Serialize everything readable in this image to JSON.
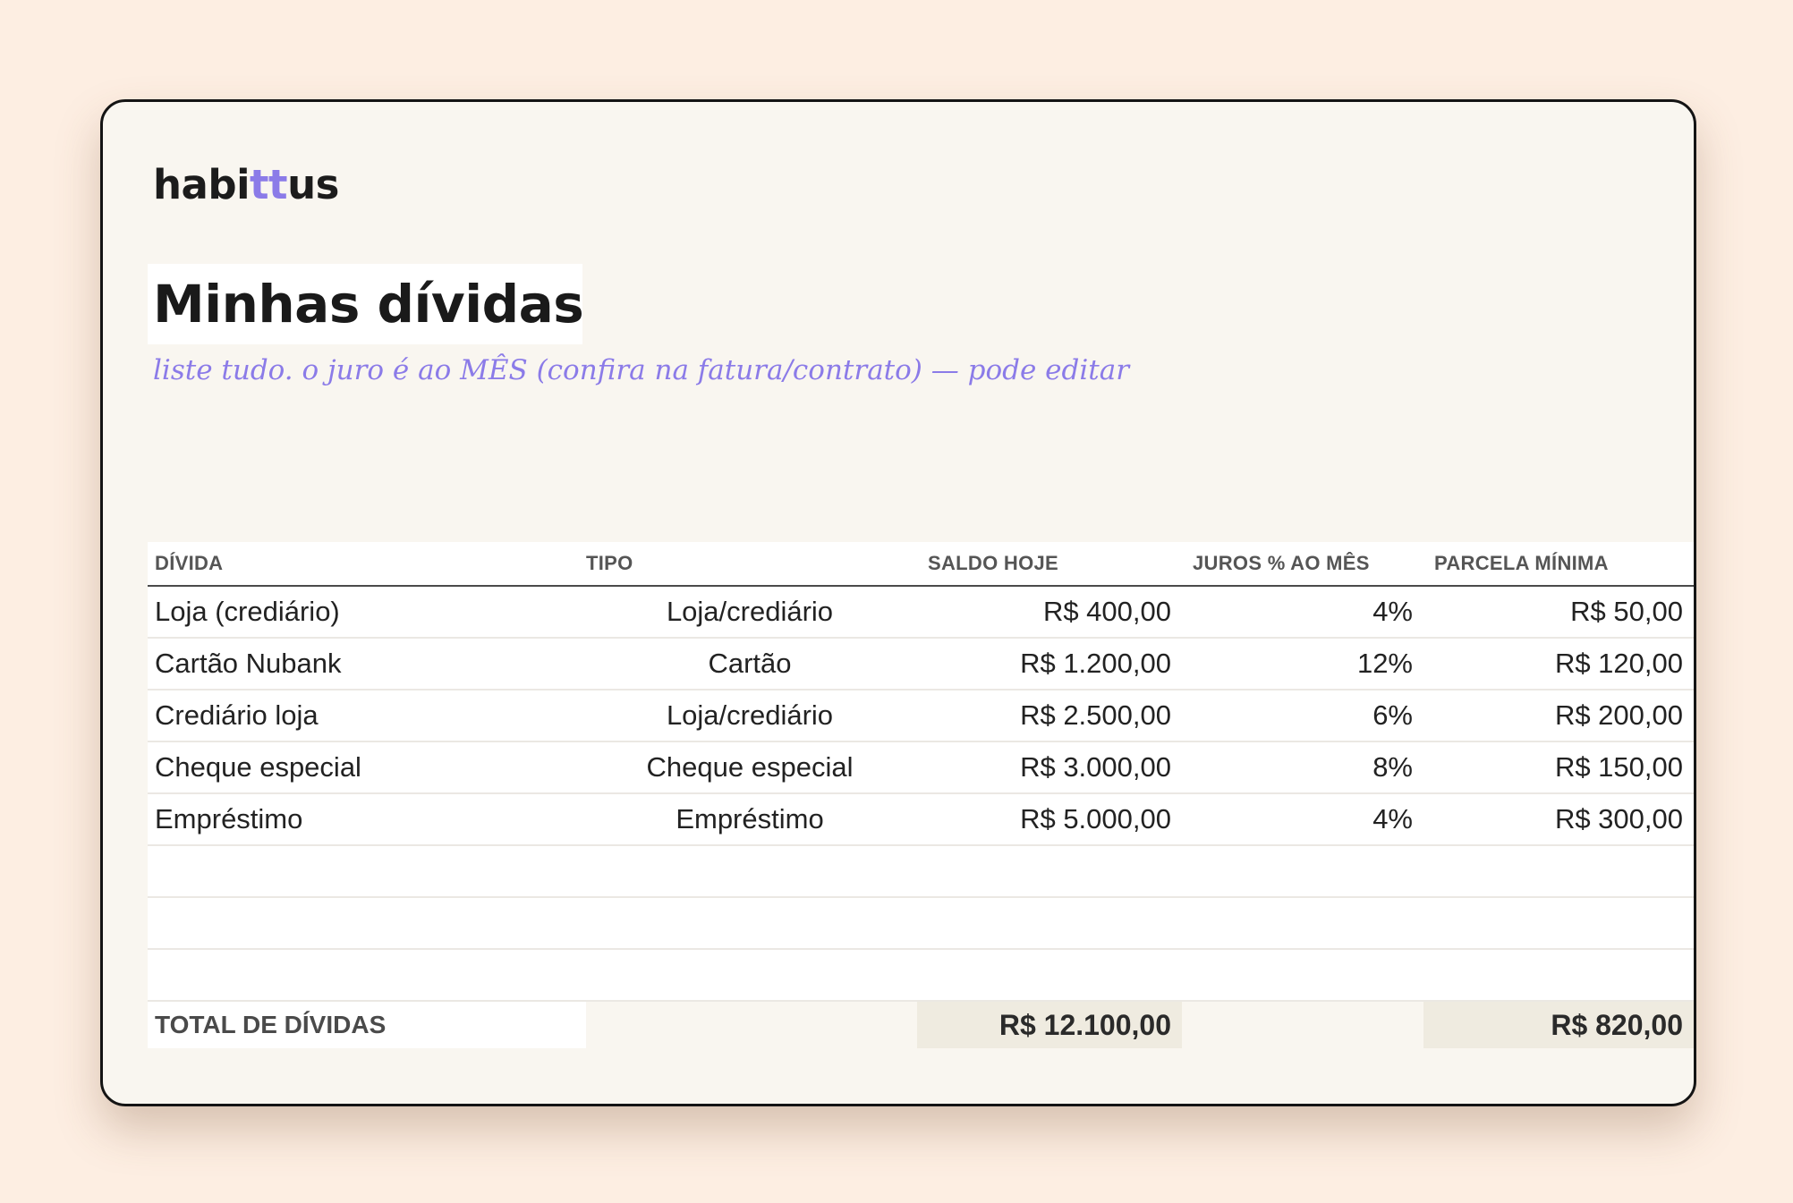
{
  "logo": {
    "text_main": "habi",
    "text_accent": "tt",
    "text_end": "us"
  },
  "page": {
    "title": "Minhas dívidas",
    "subtitle": "liste tudo. o juro é ao MÊS (confira na fatura/contrato) — pode editar"
  },
  "table": {
    "headers": {
      "divida": "DÍVIDA",
      "tipo": "TIPO",
      "saldo": "SALDO HOJE",
      "juros": "JUROS % AO MÊS",
      "parcela": "PARCELA MÍNIMA"
    },
    "rows": [
      {
        "divida": "Loja (crediário)",
        "tipo": "Loja/crediário",
        "saldo": "R$ 400,00",
        "juros": "4%",
        "parcela": "R$ 50,00"
      },
      {
        "divida": "Cartão Nubank",
        "tipo": "Cartão",
        "saldo": "R$ 1.200,00",
        "juros": "12%",
        "parcela": "R$ 120,00"
      },
      {
        "divida": "Crediário loja",
        "tipo": "Loja/crediário",
        "saldo": "R$ 2.500,00",
        "juros": "6%",
        "parcela": "R$ 200,00"
      },
      {
        "divida": "Cheque especial",
        "tipo": "Cheque especial",
        "saldo": "R$ 3.000,00",
        "juros": "8%",
        "parcela": "R$ 150,00"
      },
      {
        "divida": "Empréstimo",
        "tipo": "Empréstimo",
        "saldo": "R$ 5.000,00",
        "juros": "4%",
        "parcela": "R$ 300,00"
      }
    ],
    "total": {
      "label": "TOTAL DE DÍVIDAS",
      "saldo": "R$ 12.100,00",
      "parcela": "R$ 820,00"
    }
  },
  "colors": {
    "background": "#fdeee2",
    "card": "#f9f6f0",
    "accent": "#8b7be8"
  }
}
